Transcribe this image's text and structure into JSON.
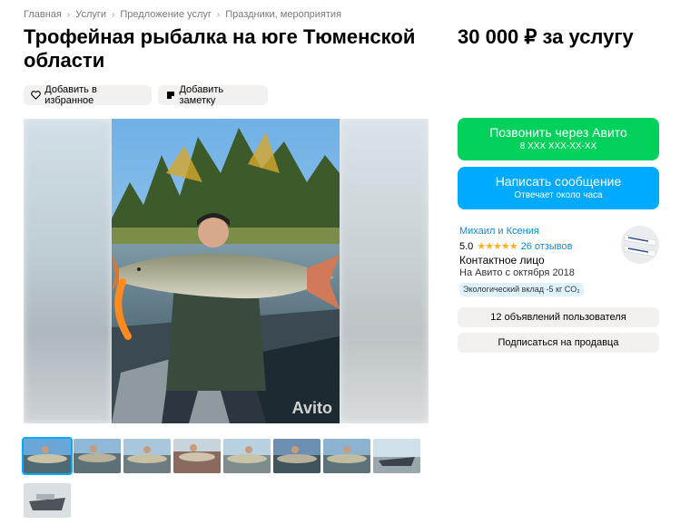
{
  "breadcrumbs": [
    "Главная",
    "Услуги",
    "Предложение услуг",
    "Праздники, мероприятия"
  ],
  "title": "Трофейная рыбалка на юге Тюменской области",
  "price": "30 000 ₽ за услугу",
  "actions": {
    "favorite_label": "Добавить в избранное",
    "note_label": "Добавить заметку"
  },
  "gallery": {
    "watermark": "Avito",
    "thumbnail_count": 9,
    "active_thumbnail": 0
  },
  "contact": {
    "call_label": "Позвонить через Авито",
    "call_sub": "8 XXX XXX-XX-XX",
    "message_label": "Написать сообщение",
    "message_sub": "Отвечает около часа"
  },
  "seller": {
    "name": "Михаил и Ксения",
    "rating": "5.0",
    "stars": "★★★★★",
    "reviews": "26 отзывов",
    "contact_type": "Контактное лицо",
    "since": "На Авито с октября 2018",
    "eco_badge": "Экологический вклад -5 кг CO₂",
    "ads_label": "12 объявлений пользователя",
    "subscribe_label": "Подписаться на продавца"
  },
  "colors": {
    "call": "#02d15c",
    "message": "#00aaff",
    "link": "#0a8ad6",
    "star": "#ffb021"
  }
}
